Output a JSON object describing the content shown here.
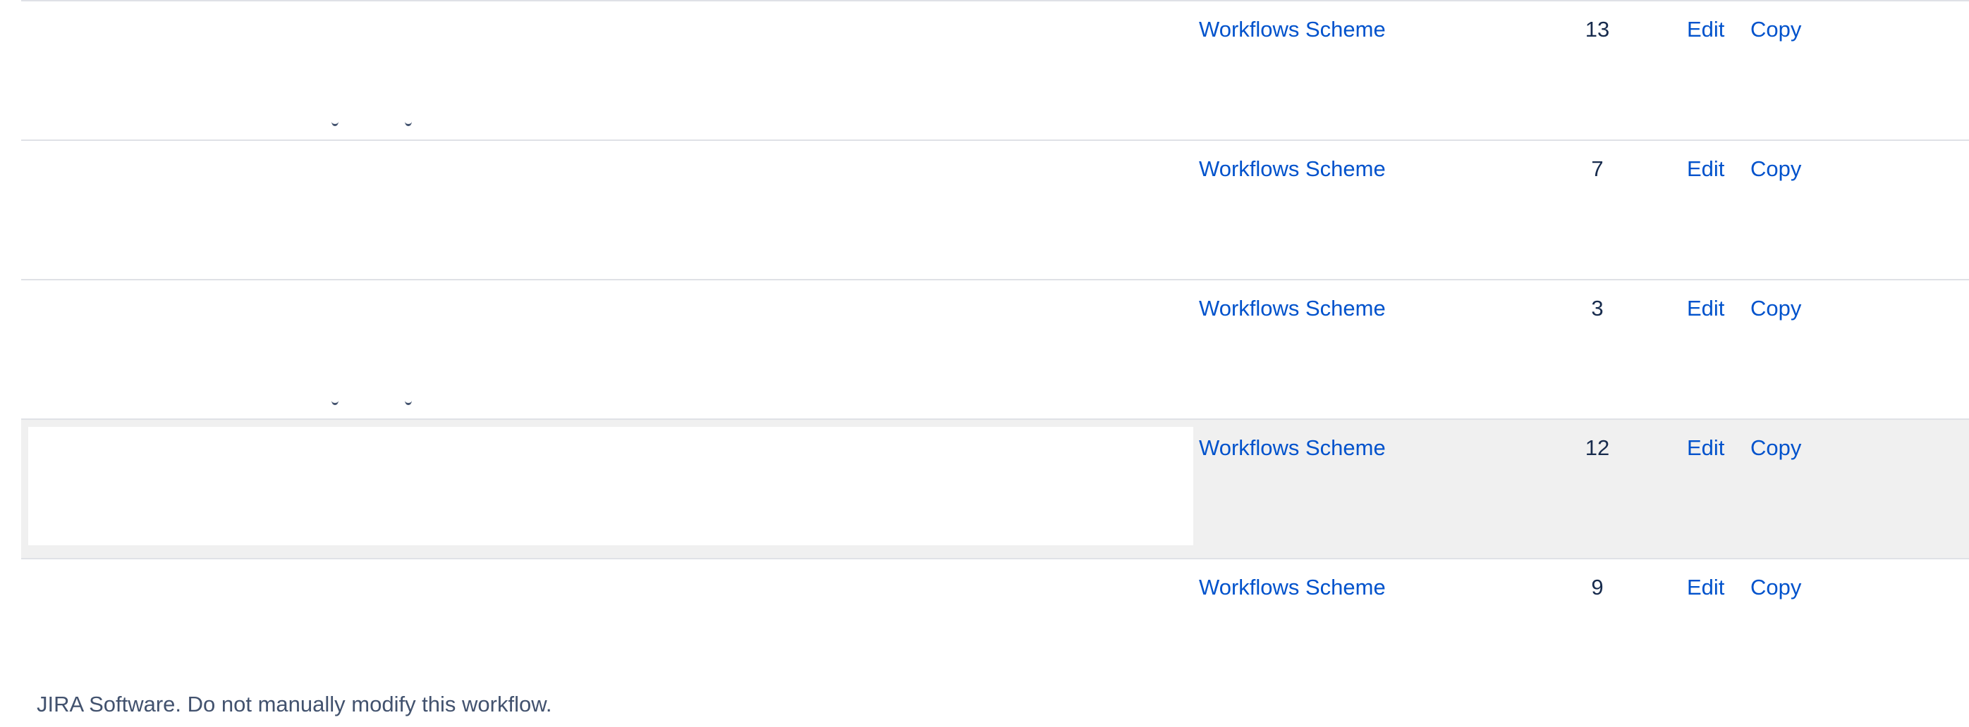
{
  "rows": [
    {
      "scheme": "Workflows Scheme",
      "count": "13",
      "edit": "Edit",
      "copy": "Copy"
    },
    {
      "scheme": "Workflows Scheme",
      "count": "7",
      "edit": "Edit",
      "copy": "Copy"
    },
    {
      "scheme": "Workflows Scheme",
      "count": "3",
      "edit": "Edit",
      "copy": "Copy"
    },
    {
      "scheme": "Workflows Scheme",
      "count": "12",
      "edit": "Edit",
      "copy": "Copy"
    },
    {
      "scheme": "Workflows Scheme",
      "count": "9",
      "edit": "Edit",
      "copy": "Copy"
    }
  ],
  "footer": {
    "note": "JIRA Software. Do not manually modify this workflow."
  },
  "colors": {
    "link": "#0052cc",
    "text": "#172b4d",
    "muted": "#42526e",
    "divider": "#dfe1e6",
    "row_highlight": "#f0f0f0"
  }
}
